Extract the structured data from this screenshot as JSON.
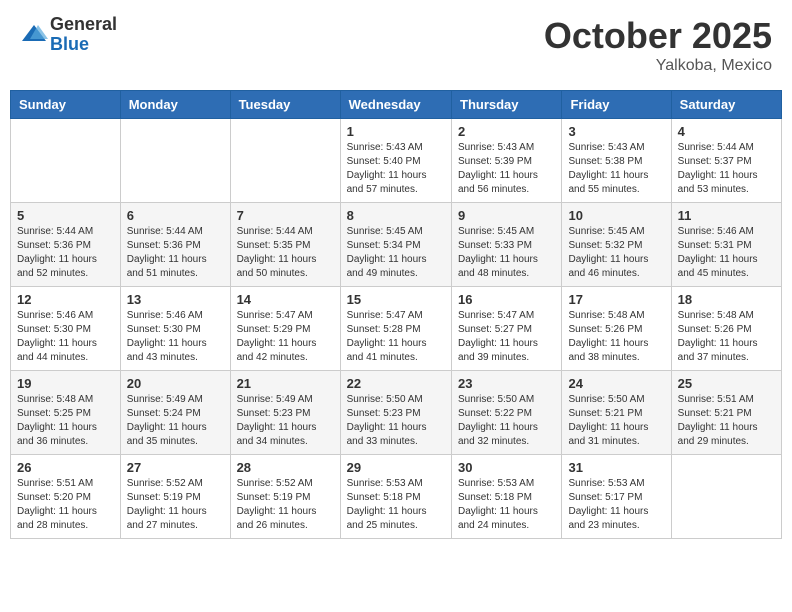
{
  "header": {
    "logo": {
      "general": "General",
      "blue": "Blue"
    },
    "month": "October 2025",
    "location": "Yalkoba, Mexico"
  },
  "days_of_week": [
    "Sunday",
    "Monday",
    "Tuesday",
    "Wednesday",
    "Thursday",
    "Friday",
    "Saturday"
  ],
  "weeks": [
    [
      {
        "day": "",
        "info": ""
      },
      {
        "day": "",
        "info": ""
      },
      {
        "day": "",
        "info": ""
      },
      {
        "day": "1",
        "info": "Sunrise: 5:43 AM\nSunset: 5:40 PM\nDaylight: 11 hours\nand 57 minutes."
      },
      {
        "day": "2",
        "info": "Sunrise: 5:43 AM\nSunset: 5:39 PM\nDaylight: 11 hours\nand 56 minutes."
      },
      {
        "day": "3",
        "info": "Sunrise: 5:43 AM\nSunset: 5:38 PM\nDaylight: 11 hours\nand 55 minutes."
      },
      {
        "day": "4",
        "info": "Sunrise: 5:44 AM\nSunset: 5:37 PM\nDaylight: 11 hours\nand 53 minutes."
      }
    ],
    [
      {
        "day": "5",
        "info": "Sunrise: 5:44 AM\nSunset: 5:36 PM\nDaylight: 11 hours\nand 52 minutes."
      },
      {
        "day": "6",
        "info": "Sunrise: 5:44 AM\nSunset: 5:36 PM\nDaylight: 11 hours\nand 51 minutes."
      },
      {
        "day": "7",
        "info": "Sunrise: 5:44 AM\nSunset: 5:35 PM\nDaylight: 11 hours\nand 50 minutes."
      },
      {
        "day": "8",
        "info": "Sunrise: 5:45 AM\nSunset: 5:34 PM\nDaylight: 11 hours\nand 49 minutes."
      },
      {
        "day": "9",
        "info": "Sunrise: 5:45 AM\nSunset: 5:33 PM\nDaylight: 11 hours\nand 48 minutes."
      },
      {
        "day": "10",
        "info": "Sunrise: 5:45 AM\nSunset: 5:32 PM\nDaylight: 11 hours\nand 46 minutes."
      },
      {
        "day": "11",
        "info": "Sunrise: 5:46 AM\nSunset: 5:31 PM\nDaylight: 11 hours\nand 45 minutes."
      }
    ],
    [
      {
        "day": "12",
        "info": "Sunrise: 5:46 AM\nSunset: 5:30 PM\nDaylight: 11 hours\nand 44 minutes."
      },
      {
        "day": "13",
        "info": "Sunrise: 5:46 AM\nSunset: 5:30 PM\nDaylight: 11 hours\nand 43 minutes."
      },
      {
        "day": "14",
        "info": "Sunrise: 5:47 AM\nSunset: 5:29 PM\nDaylight: 11 hours\nand 42 minutes."
      },
      {
        "day": "15",
        "info": "Sunrise: 5:47 AM\nSunset: 5:28 PM\nDaylight: 11 hours\nand 41 minutes."
      },
      {
        "day": "16",
        "info": "Sunrise: 5:47 AM\nSunset: 5:27 PM\nDaylight: 11 hours\nand 39 minutes."
      },
      {
        "day": "17",
        "info": "Sunrise: 5:48 AM\nSunset: 5:26 PM\nDaylight: 11 hours\nand 38 minutes."
      },
      {
        "day": "18",
        "info": "Sunrise: 5:48 AM\nSunset: 5:26 PM\nDaylight: 11 hours\nand 37 minutes."
      }
    ],
    [
      {
        "day": "19",
        "info": "Sunrise: 5:48 AM\nSunset: 5:25 PM\nDaylight: 11 hours\nand 36 minutes."
      },
      {
        "day": "20",
        "info": "Sunrise: 5:49 AM\nSunset: 5:24 PM\nDaylight: 11 hours\nand 35 minutes."
      },
      {
        "day": "21",
        "info": "Sunrise: 5:49 AM\nSunset: 5:23 PM\nDaylight: 11 hours\nand 34 minutes."
      },
      {
        "day": "22",
        "info": "Sunrise: 5:50 AM\nSunset: 5:23 PM\nDaylight: 11 hours\nand 33 minutes."
      },
      {
        "day": "23",
        "info": "Sunrise: 5:50 AM\nSunset: 5:22 PM\nDaylight: 11 hours\nand 32 minutes."
      },
      {
        "day": "24",
        "info": "Sunrise: 5:50 AM\nSunset: 5:21 PM\nDaylight: 11 hours\nand 31 minutes."
      },
      {
        "day": "25",
        "info": "Sunrise: 5:51 AM\nSunset: 5:21 PM\nDaylight: 11 hours\nand 29 minutes."
      }
    ],
    [
      {
        "day": "26",
        "info": "Sunrise: 5:51 AM\nSunset: 5:20 PM\nDaylight: 11 hours\nand 28 minutes."
      },
      {
        "day": "27",
        "info": "Sunrise: 5:52 AM\nSunset: 5:19 PM\nDaylight: 11 hours\nand 27 minutes."
      },
      {
        "day": "28",
        "info": "Sunrise: 5:52 AM\nSunset: 5:19 PM\nDaylight: 11 hours\nand 26 minutes."
      },
      {
        "day": "29",
        "info": "Sunrise: 5:53 AM\nSunset: 5:18 PM\nDaylight: 11 hours\nand 25 minutes."
      },
      {
        "day": "30",
        "info": "Sunrise: 5:53 AM\nSunset: 5:18 PM\nDaylight: 11 hours\nand 24 minutes."
      },
      {
        "day": "31",
        "info": "Sunrise: 5:53 AM\nSunset: 5:17 PM\nDaylight: 11 hours\nand 23 minutes."
      },
      {
        "day": "",
        "info": ""
      }
    ]
  ]
}
